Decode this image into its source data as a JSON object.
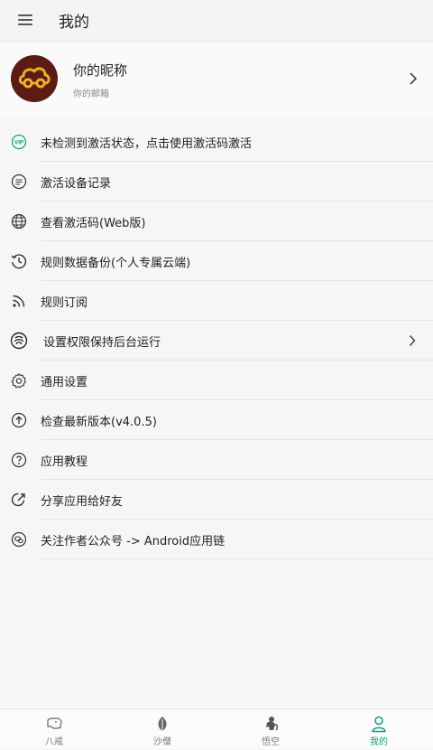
{
  "app_bar": {
    "title": "我的",
    "menu_icon": "hamburger-menu-icon"
  },
  "profile": {
    "nickname": "你的昵称",
    "email": "你的邮箱",
    "avatar_colors": {
      "background": "#5b1c13",
      "cloud": "#f0ae2a"
    }
  },
  "menu_items": [
    {
      "label": "未检测到激活状态，点击使用激活码激活",
      "icon": "vip-icon"
    },
    {
      "label": "激活设备记录",
      "icon": "list-circle-icon"
    },
    {
      "label": "查看激活码(Web版)",
      "icon": "globe-icon"
    },
    {
      "label": "规则数据备份(个人专属云端)",
      "icon": "history-icon"
    },
    {
      "label": "规则订阅",
      "icon": "rss-icon"
    },
    {
      "label": "设置权限保持后台运行",
      "icon": "fingerprint-icon"
    },
    {
      "label": "通用设置",
      "icon": "gear-icon"
    },
    {
      "label": "检查最新版本(v4.0.5)",
      "icon": "upload-circle-icon"
    },
    {
      "label": "应用教程",
      "icon": "help-circle-icon"
    },
    {
      "label": "分享应用给好友",
      "icon": "share-icon"
    },
    {
      "label": "关注作者公众号 -> Android应用链",
      "icon": "wechat-icon"
    }
  ],
  "bottom_nav": {
    "active_index": 3,
    "tabs": [
      {
        "label": "八戒",
        "icon": "pig-icon"
      },
      {
        "label": "沙僧",
        "icon": "leaf-icon"
      },
      {
        "label": "悟空",
        "icon": "monkey-icon"
      },
      {
        "label": "我的",
        "icon": "person-icon"
      }
    ]
  },
  "colors": {
    "accent": "#149e7e",
    "background": "#f6f6f6",
    "divider": "#e3e3e3"
  }
}
